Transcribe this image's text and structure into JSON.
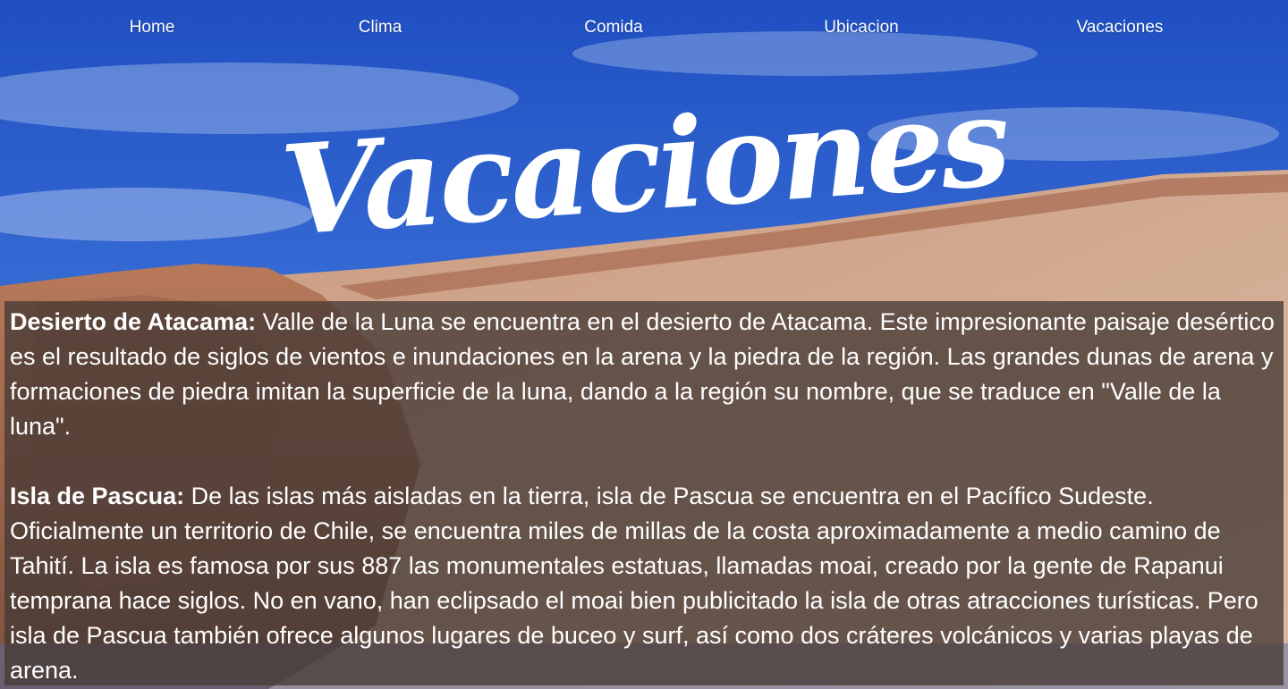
{
  "nav": {
    "home": "Home",
    "clima": "Clima",
    "comida": "Comida",
    "ubicacion": "Ubicacion",
    "vacaciones": "Vacaciones"
  },
  "hero": {
    "title": "Vacaciones"
  },
  "sections": [
    {
      "heading": "Desierto de Atacama:",
      "body": "Valle de la Luna se encuentra en el desierto de Atacama. Este impresionante paisaje desértico es el resultado de siglos de vientos e inundaciones en la arena y la piedra de la región. Las grandes dunas de arena y formaciones de piedra imitan la superficie de la luna, dando a la región su nombre, que se traduce en \"Valle de la luna\"."
    },
    {
      "heading": "Isla de Pascua:",
      "body": "De las islas más aisladas en la tierra, isla de Pascua se encuentra en el Pacífico Sudeste. Oficialmente un territorio de Chile, se encuentra miles de millas de la costa aproximadamente a medio camino de Tahití. La isla es famosa por sus 887 las monumentales estatuas, llamadas moai, creado por la gente de Rapanui temprana hace siglos. No en vano, han eclipsado el moai bien publicitado la isla de otras atracciones turísticas. Pero isla de Pascua también ofrece algunos lugares de buceo y surf, así como dos cráteres volcánicos y varias playas de arena."
    }
  ]
}
